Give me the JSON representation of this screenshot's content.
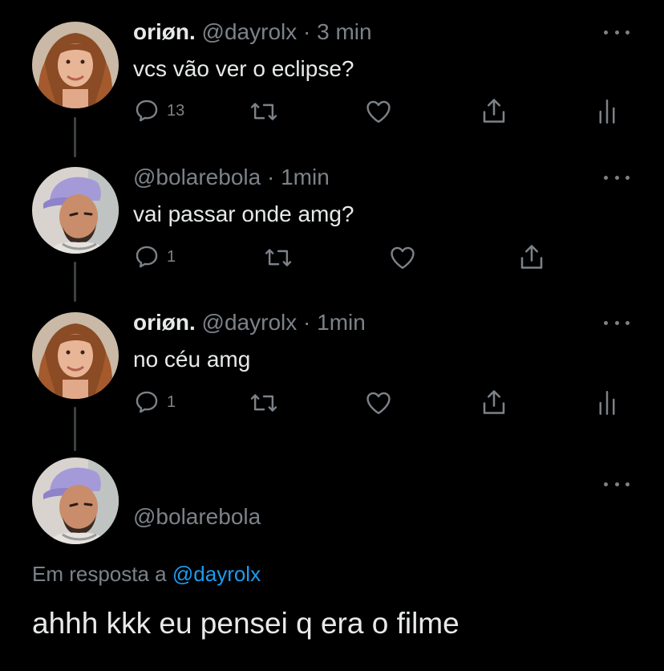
{
  "tweets": [
    {
      "name": "oriøn.",
      "handle": "@dayrolx",
      "dot": "·",
      "time": "3 min",
      "text": "vcs vão ver o eclipse?",
      "reply_count": "13",
      "avatar": "red-haired-woman-avatar"
    },
    {
      "name": "",
      "handle": "@bolarebola",
      "dot": "·",
      "time": "1min",
      "text": "vai passar onde amg?",
      "reply_count": "1",
      "avatar": "man-with-lilac-cap-avatar"
    },
    {
      "name": "oriøn.",
      "handle": "@dayrolx",
      "dot": "·",
      "time": "1min",
      "text": "no céu amg",
      "reply_count": "1",
      "avatar": "red-haired-woman-avatar"
    }
  ],
  "main_tweet": {
    "handle": "@bolarebola",
    "reply_prefix": "Em resposta a",
    "reply_handle": "@dayrolx",
    "text": "ahhh kkk eu pensei q era o filme",
    "avatar": "man-with-lilac-cap-avatar"
  },
  "icons": {
    "reply": "reply-bubble-icon",
    "retweet": "retweet-icon",
    "like": "heart-icon",
    "share": "share-icon",
    "analytics": "analytics-icon",
    "more": "more-dots-icon"
  },
  "colors": {
    "background": "#000000",
    "text": "#e7e9ea",
    "muted": "#7c8288",
    "link": "#1d9bf0",
    "thread_line": "#3e4144"
  }
}
